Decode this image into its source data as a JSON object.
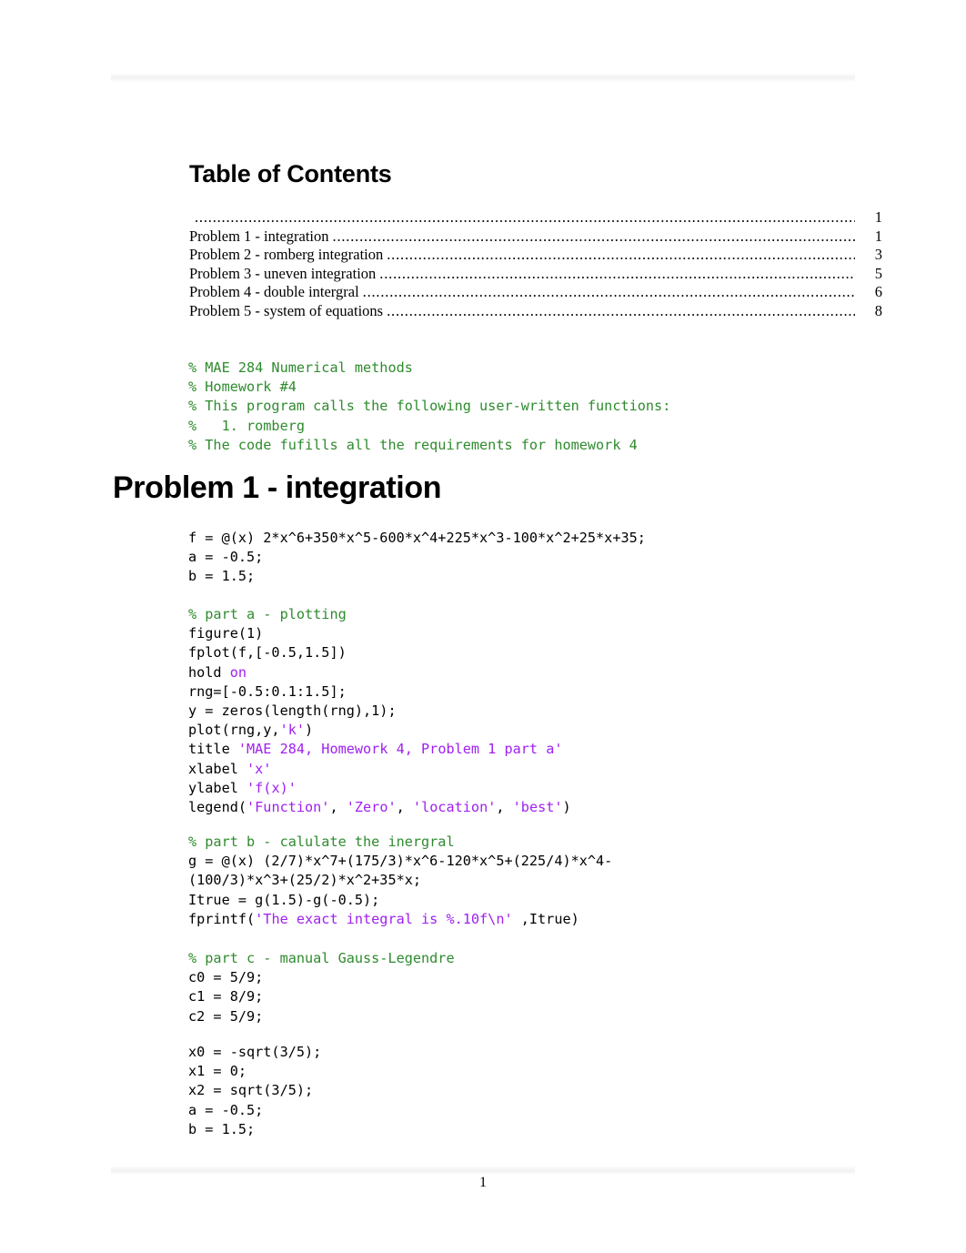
{
  "document": {
    "page_number": "1",
    "toc_heading": "Table of Contents",
    "section_heading": "Problem 1 - integration"
  },
  "toc": {
    "entries": [
      {
        "label": "",
        "page": "1"
      },
      {
        "label": "Problem 1 - integration",
        "page": "1"
      },
      {
        "label": "Problem 2 - romberg integration",
        "page": "3"
      },
      {
        "label": "Problem 3 - uneven integration",
        "page": "5"
      },
      {
        "label": "Problem 4 - double intergral",
        "page": "6"
      },
      {
        "label": "Problem 5 - system of equations",
        "page": "8"
      }
    ],
    "dot_leader": "........................................................................................................................................................"
  },
  "colors": {
    "comment_green": "#2E8B2E",
    "string_magenta": "#A020F0",
    "text_black": "#000000",
    "rule_gray": "#f3f3f4"
  },
  "header_comment_block": {
    "line_1": "% MAE 284 Numerical methods",
    "line_2": "% Homework #4",
    "line_3": "% This program calls the following user-written functions:",
    "line_4": "%   1. romberg",
    "line_5": "% The code fufills all the requirements for homework 4"
  },
  "code_block_1": {
    "line_1": "f = @(x) 2*x^6+350*x^5-600*x^4+225*x^3-100*x^2+25*x+35;",
    "line_2": "a = -0.5;",
    "line_3": "b = 1.5;"
  },
  "code_block_2": {
    "comment": "% part a - plotting",
    "line_1": "figure(1)",
    "line_2": "fplot(f,[-0.5,1.5])",
    "line_3_pre": "hold ",
    "line_3_kw": "on",
    "line_4": "rng=[-0.5:0.1:1.5];",
    "line_5": "y = zeros(length(rng),1);",
    "line_6_pre": "plot(rng,y,",
    "line_6_str": "'k'",
    "line_6_post": ")",
    "line_7_pre": "title ",
    "line_7_str": "'MAE 284, Homework 4, Problem 1 part a'",
    "line_8_pre": "xlabel ",
    "line_8_str": "'x'",
    "line_9_pre": "ylabel ",
    "line_9_str": "'f(x)'",
    "line_10_pre": "legend(",
    "line_10_str1": "'Function'",
    "line_10_sep1": ", ",
    "line_10_str2": "'Zero'",
    "line_10_sep2": ", ",
    "line_10_str3": "'location'",
    "line_10_sep3": ", ",
    "line_10_str4": "'best'",
    "line_10_post": ")"
  },
  "code_block_3": {
    "comment": "% part b - calulate the inergral",
    "line_1": "g = @(x) (2/7)*x^7+(175/3)*x^6-120*x^5+(225/4)*x^4-",
    "line_2": "(100/3)*x^3+(25/2)*x^2+35*x;",
    "line_3": "Itrue = g(1.5)-g(-0.5);",
    "line_4_pre": "fprintf(",
    "line_4_str": "'The exact integral is %.10f\\n'",
    "line_4_post": " ,Itrue)"
  },
  "code_block_4": {
    "comment": "% part c - manual Gauss-Legendre",
    "line_1": "c0 = 5/9;",
    "line_2": "c1 = 8/9;",
    "line_3": "c2 = 5/9;"
  },
  "code_block_5": {
    "line_1": "x0 = -sqrt(3/5);",
    "line_2": "x1 = 0;",
    "line_3": "x2 = sqrt(3/5);",
    "line_4": "a = -0.5;",
    "line_5": "b = 1.5;"
  }
}
